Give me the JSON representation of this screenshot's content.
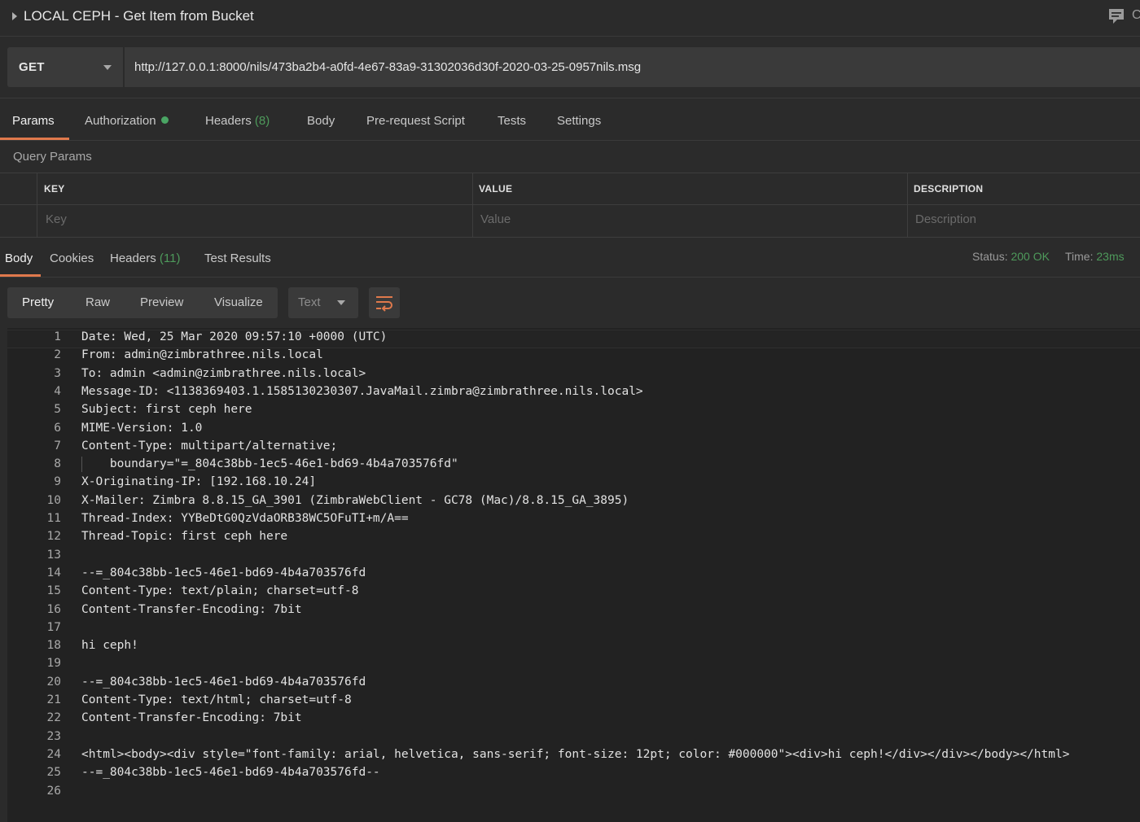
{
  "title": {
    "request_name": "LOCAL CEPH - Get Item from Bucket",
    "trailing_text": "C"
  },
  "request": {
    "method": "GET",
    "url": "http://127.0.0.1:8000/nils/473ba2b4-a0fd-4e67-83a9-31302036d30f-2020-03-25-0957nils.msg"
  },
  "request_tabs": {
    "params": "Params",
    "authorization": "Authorization",
    "headers": "Headers",
    "headers_count": "(8)",
    "body": "Body",
    "prerequest": "Pre-request Script",
    "tests": "Tests",
    "settings": "Settings"
  },
  "query_params": {
    "title": "Query Params",
    "columns": {
      "key": "KEY",
      "value": "VALUE",
      "description": "DESCRIPTION"
    },
    "placeholders": {
      "key": "Key",
      "value": "Value",
      "description": "Description"
    }
  },
  "response_tabs": {
    "body": "Body",
    "cookies": "Cookies",
    "headers": "Headers",
    "headers_count": "(11)",
    "test_results": "Test Results"
  },
  "response_status": {
    "status_label": "Status:",
    "status_value": "200 OK",
    "time_label": "Time:",
    "time_value": "23ms"
  },
  "view_options": {
    "pretty": "Pretty",
    "raw": "Raw",
    "preview": "Preview",
    "visualize": "Visualize",
    "format": "Text"
  },
  "colors": {
    "accent": "#e0794c",
    "status_green": "#4e9a5b",
    "auth_dot": "#4aa564"
  },
  "response_body": {
    "lines": [
      "Date: Wed, 25 Mar 2020 09:57:10 +0000 (UTC)",
      "From: admin@zimbrathree.nils.local",
      "To: admin <admin@zimbrathree.nils.local>",
      "Message-ID: <1138369403.1.1585130230307.JavaMail.zimbra@zimbrathree.nils.local>",
      "Subject: first ceph here",
      "MIME-Version: 1.0",
      "Content-Type: multipart/alternative;",
      "    boundary=\"=_804c38bb-1ec5-46e1-bd69-4b4a703576fd\"",
      "X-Originating-IP: [192.168.10.24]",
      "X-Mailer: Zimbra 8.8.15_GA_3901 (ZimbraWebClient - GC78 (Mac)/8.8.15_GA_3895)",
      "Thread-Index: YYBeDtG0QzVdaORB38WC5OFuTI+m/A==",
      "Thread-Topic: first ceph here",
      "",
      "--=_804c38bb-1ec5-46e1-bd69-4b4a703576fd",
      "Content-Type: text/plain; charset=utf-8",
      "Content-Transfer-Encoding: 7bit",
      "",
      "hi ceph!",
      "",
      "--=_804c38bb-1ec5-46e1-bd69-4b4a703576fd",
      "Content-Type: text/html; charset=utf-8",
      "Content-Transfer-Encoding: 7bit",
      "",
      "<html><body><div style=\"font-family: arial, helvetica, sans-serif; font-size: 12pt; color: #000000\"><div>hi ceph!</div></div></body></html>",
      "--=_804c38bb-1ec5-46e1-bd69-4b4a703576fd--",
      ""
    ]
  }
}
